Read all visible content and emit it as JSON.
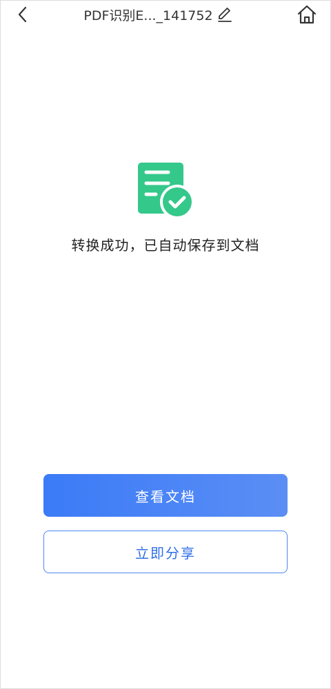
{
  "header": {
    "title": "PDF识别E..._141752",
    "back_icon": "back-chevron-icon",
    "edit_icon": "edit-pencil-icon",
    "home_icon": "home-icon"
  },
  "main": {
    "status_icon": "document-check-icon",
    "status_message": "转换成功，已自动保存到文档",
    "accent_green": "#34c88a"
  },
  "actions": {
    "view_label": "查看文档",
    "share_label": "立即分享",
    "primary_color": "#3b7bf7"
  }
}
